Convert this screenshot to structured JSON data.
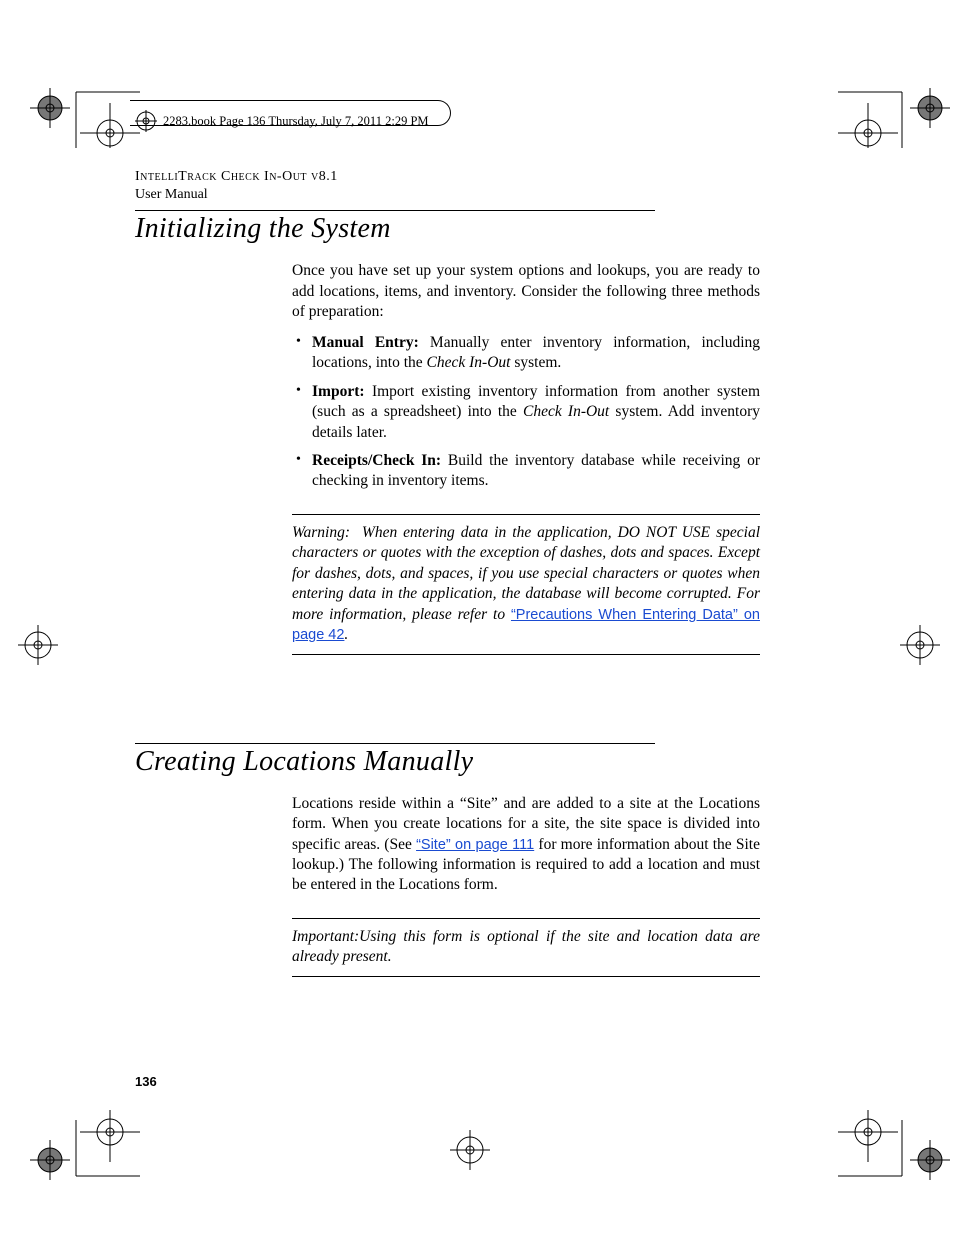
{
  "meta": {
    "book_line": "2283.book  Page 136  Thursday, July 7, 2011  2:29 PM"
  },
  "header": {
    "product": "IntelliTrack Check In-Out v8.1",
    "subtitle": "User Manual"
  },
  "section1": {
    "title": "Initializing the System",
    "intro": "Once you have set up your system options and lookups, you are ready to add locations, items, and inventory. Consider the following three methods of preparation:",
    "bullets": [
      {
        "lead": "Manual Entry:",
        "text_before": " Manually enter inventory information, including locations, into the ",
        "italic": "Check In-Out",
        "text_after": " system."
      },
      {
        "lead": "Import:",
        "text_before": " Import existing inventory information from another system (such as a spreadsheet) into the ",
        "italic": "Check In-Out",
        "text_after": " system. Add inventory details later."
      },
      {
        "lead": "Receipts/Check In:",
        "text_before": " Build the inventory database while receiving or checking in inventory items.",
        "italic": "",
        "text_after": ""
      }
    ],
    "warning": {
      "label": "Warning:",
      "body": "When entering data in the application, DO NOT USE special characters or quotes with the exception of dashes, dots and spaces. Except for dashes, dots, and spaces, if you use special characters or quotes when entering data in the application, the database will become corrupted. For more information, please refer to ",
      "link": "“Precautions When Entering Data” on page 42",
      "after": "."
    }
  },
  "section2": {
    "title": "Creating Locations Manually",
    "para_before": "Locations reside within a “Site” and are added to a site at the Locations form. When you create locations for a site, the site space is divided into specific areas. (See ",
    "link": "“Site” on page 111",
    "para_after": " for more information about the Site lookup.) The following information is required to add a location and must be entered in the Locations form.",
    "important": {
      "label": "Important:",
      "body": "Using this form is optional if the site and location data are already present."
    }
  },
  "page_number": "136"
}
